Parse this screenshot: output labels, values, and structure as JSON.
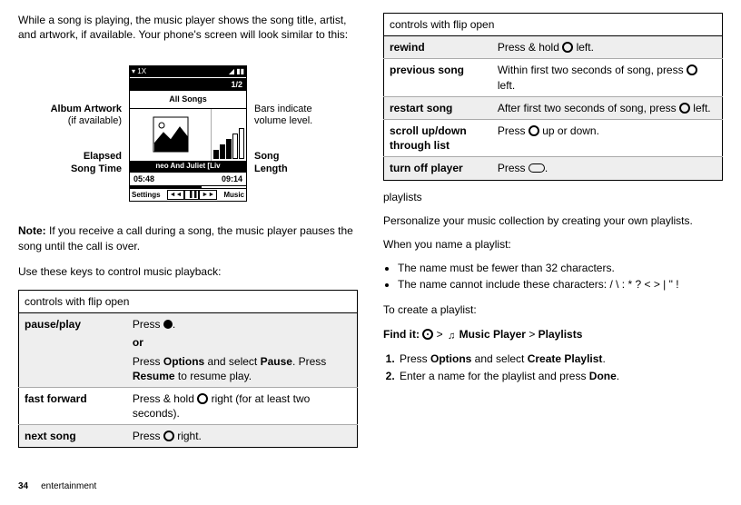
{
  "left": {
    "intro": "While a song is playing, the music player shows the song title, artist, and artwork, if available. Your phone's screen will look similar to this:",
    "callouts": {
      "albumArtwork": "Album Artwork",
      "ifAvailable": "(if available)",
      "elapsed1": "Elapsed",
      "elapsed2": "Song Time",
      "bars1": "Bars indicate",
      "bars2": "volume level.",
      "song1": "Song",
      "song2": "Length"
    },
    "phone": {
      "statusL": "1X",
      "statusR": "",
      "counter": "1/2",
      "allSongs": "All Songs",
      "songName": "neo And Juliet [Liv",
      "elapsed": "05:48",
      "length": "09:14",
      "softLeft": "Settings",
      "softRight": "Music"
    },
    "note": "Note:",
    "noteBody": " If you receive a call during a song, the music player pauses the song until the call is over.",
    "useKeys": "Use these keys to control music playback:",
    "tableHeader": "controls with flip open",
    "rows": {
      "r1a": "pause/play",
      "r1b": "Press ",
      "r1c": ".",
      "r1or": "or",
      "r1d1": "Press ",
      "r1d2": "Options",
      "r1d3": " and select ",
      "r1d4": "Pause",
      "r1d5": ". Press ",
      "r1d6": "Resume",
      "r1d7": " to resume play.",
      "r2a": "fast forward",
      "r2b1": "Press & hold ",
      "r2b2": " right (for at least two seconds).",
      "r3a": "next song",
      "r3b1": "Press ",
      "r3b2": " right."
    }
  },
  "right": {
    "tableHeader": "controls with flip open",
    "rows": {
      "r1a": "rewind",
      "r1b1": "Press & hold ",
      "r1b2": " left.",
      "r2a": "previous song",
      "r2b1": "Within first two seconds of song, press ",
      "r2b2": " left.",
      "r3a": "restart song",
      "r3b1": "After first two seconds of song, press ",
      "r3b2": " left.",
      "r4a": "scroll up/down through list",
      "r4b1": "Press ",
      "r4b2": " up or down.",
      "r5a": "turn off player",
      "r5b1": "Press ",
      "r5b2": "."
    },
    "playlistsHeading": "playlists",
    "playlistsIntro": "Personalize your music collection by creating your own playlists.",
    "whenName": "When you name a playlist:",
    "bullet1": "The name must be fewer than 32 characters.",
    "bullet2": "The name cannot include these characters: / \\ : * ? < > | \" !",
    "toCreate": "To create a playlist:",
    "findIt": "Find it: ",
    "findPath1": " > ",
    "findMusic": "Music Player",
    "findPath2": " > ",
    "findPlaylists": "Playlists",
    "step1a": "Press ",
    "step1b": "Options",
    "step1c": " and select ",
    "step1d": "Create Playlist",
    "step1e": ".",
    "step2a": "Enter a name for the playlist and press ",
    "step2b": "Done",
    "step2c": "."
  },
  "footer": {
    "page": "34",
    "section": "entertainment"
  }
}
